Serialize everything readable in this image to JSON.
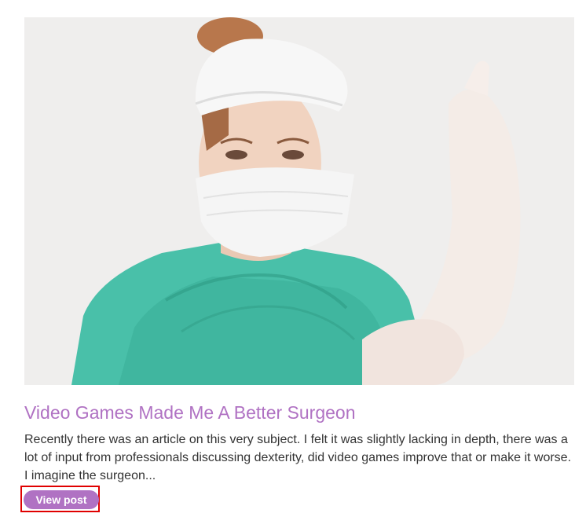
{
  "post": {
    "image_subject": "surgeon-putting-on-glove-photo",
    "title": "Video Games Made Me A Better Surgeon",
    "excerpt": "Recently there was an article on this very subject. I felt it was slightly lacking in depth, there was a lot of input from professionals discussing dexterity, did video games improve that or make it worse. I imagine the surgeon...",
    "button_label": "View post"
  },
  "colors": {
    "accent": "#b072c3",
    "highlight_border": "#e00000",
    "text": "#333333"
  }
}
